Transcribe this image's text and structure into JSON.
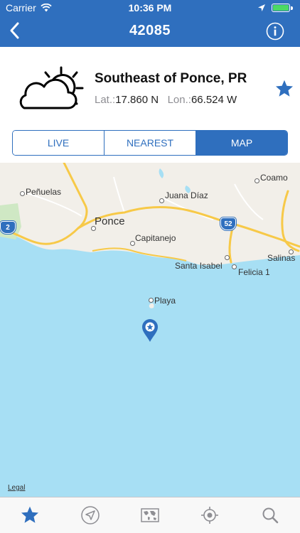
{
  "status_bar": {
    "carrier": "Carrier",
    "time": "10:36 PM"
  },
  "nav": {
    "title": "42085",
    "back_icon": "chevron-left-icon",
    "info_icon": "info-icon"
  },
  "station": {
    "name": "Southeast of Ponce, PR",
    "lat_label": "Lat.:",
    "lat_value": "17.860 N",
    "lon_label": "Lon.:",
    "lon_value": "66.524 W",
    "weather_icon": "partly-cloudy-icon",
    "favorite_icon": "star-icon"
  },
  "segments": [
    {
      "label": "LIVE",
      "active": false
    },
    {
      "label": "NEAREST",
      "active": false
    },
    {
      "label": "MAP",
      "active": true
    }
  ],
  "map": {
    "places": [
      "Peñuelas",
      "Juana Díaz",
      "Coamo",
      "Ponce",
      "Capitanejo",
      "Santa Isabel",
      "Felicia 1",
      "Salinas",
      "Playa"
    ],
    "shields": [
      "2",
      "52"
    ],
    "legal": "Legal",
    "marker_icon": "buoy-pin-icon"
  },
  "tabs": [
    {
      "icon": "star-icon",
      "active": true
    },
    {
      "icon": "location-arrow-icon",
      "active": false
    },
    {
      "icon": "world-map-icon",
      "active": false
    },
    {
      "icon": "crosshair-icon",
      "active": false
    },
    {
      "icon": "search-icon",
      "active": false
    }
  ],
  "colors": {
    "accent": "#2f6fbe",
    "water": "#a7dff4",
    "land": "#f2efe9",
    "road": "#f7c948"
  }
}
